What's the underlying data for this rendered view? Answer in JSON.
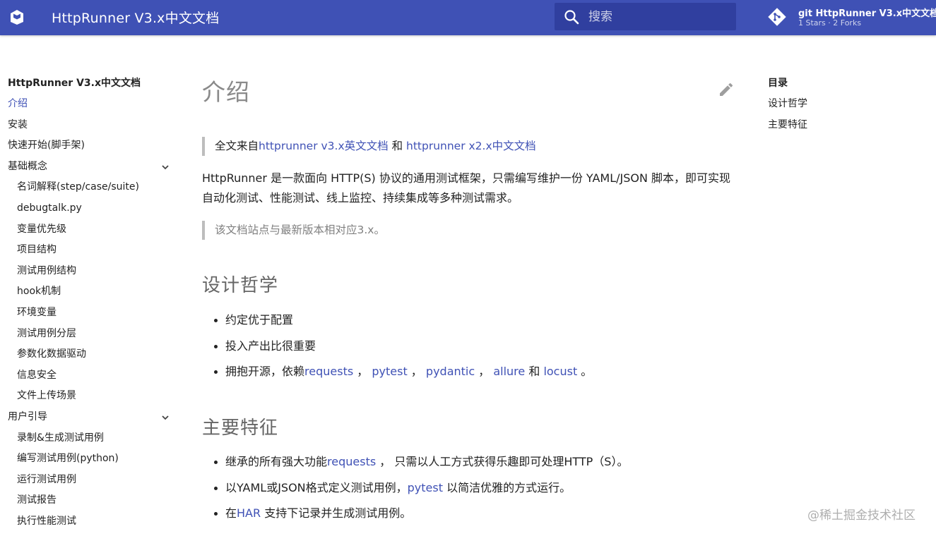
{
  "header": {
    "site_title": "HttpRunner V3.x中文文档",
    "search_placeholder": "搜索",
    "repo_name": "git HttpRunner V3.x中文文档",
    "repo_stats": "1 Stars · 2 Forks",
    "colors": {
      "primary": "#3f51b5",
      "search_bg": "#303f9f"
    }
  },
  "nav": {
    "title": "HttpRunner V3.x中文文档",
    "items": [
      {
        "label": "介绍",
        "active": true
      },
      {
        "label": "安装"
      },
      {
        "label": "快速开始(脚手架)"
      },
      {
        "label": "基础概念",
        "expandable": true
      },
      {
        "label": "名词解释(step/case/suite)",
        "sub": true
      },
      {
        "label": "debugtalk.py",
        "sub": true
      },
      {
        "label": "变量优先级",
        "sub": true
      },
      {
        "label": "项目结构",
        "sub": true
      },
      {
        "label": "测试用例结构",
        "sub": true
      },
      {
        "label": "hook机制",
        "sub": true
      },
      {
        "label": "环境变量",
        "sub": true
      },
      {
        "label": "测试用例分层",
        "sub": true
      },
      {
        "label": "参数化数据驱动",
        "sub": true
      },
      {
        "label": "信息安全",
        "sub": true
      },
      {
        "label": "文件上传场景",
        "sub": true
      },
      {
        "label": "用户引导",
        "expandable": true
      },
      {
        "label": "录制&生成测试用例",
        "sub": true
      },
      {
        "label": "编写测试用例(python)",
        "sub": true
      },
      {
        "label": "运行测试用例",
        "sub": true
      },
      {
        "label": "测试报告",
        "sub": true
      },
      {
        "label": "执行性能测试",
        "sub": true
      }
    ]
  },
  "main": {
    "title": "介绍",
    "quote1": {
      "prefix": "全文来自",
      "link1": "httprunner v3.x英文文档",
      "middle": " 和 ",
      "link2": "httprunner x2.x中文文档"
    },
    "intro": "HttpRunner 是一款面向 HTTP(S) 协议的通用测试框架，只需编写维护一份 YAML/JSON 脚本，即可实现自动化测试、性能测试、线上监控、持续集成等多种测试需求。",
    "quote2": "该文档站点与最新版本相对应3.x。",
    "section1": {
      "heading": "设计哲学",
      "item1": "约定优于配置",
      "item2": "投入产出比很重要",
      "item3": {
        "prefix": "拥抱开源，依赖",
        "l1": "requests",
        "s1": " ， ",
        "l2": "pytest",
        "s2": " ， ",
        "l3": "pydantic",
        "s3": " ， ",
        "l4": "allure",
        "s4": " 和 ",
        "l5": "locust",
        "suffix": " 。"
      }
    },
    "section2": {
      "heading": "主要特征",
      "item1": {
        "prefix": "继承的所有强大功能",
        "link": "requests",
        "suffix": " ， 只需以人工方式获得乐趣即可处理HTTP（S）。"
      },
      "item2": {
        "prefix": "以YAML或JSON格式定义测试用例，",
        "link": "pytest",
        "suffix": " 以简洁优雅的方式运行。"
      },
      "item3": {
        "prefix": "在",
        "link": "HAR",
        "suffix": " 支持下记录并生成测试用例。"
      }
    }
  },
  "toc": {
    "title": "目录",
    "items": [
      "设计哲学",
      "主要特征"
    ]
  },
  "watermark": "@稀土掘金技术社区"
}
